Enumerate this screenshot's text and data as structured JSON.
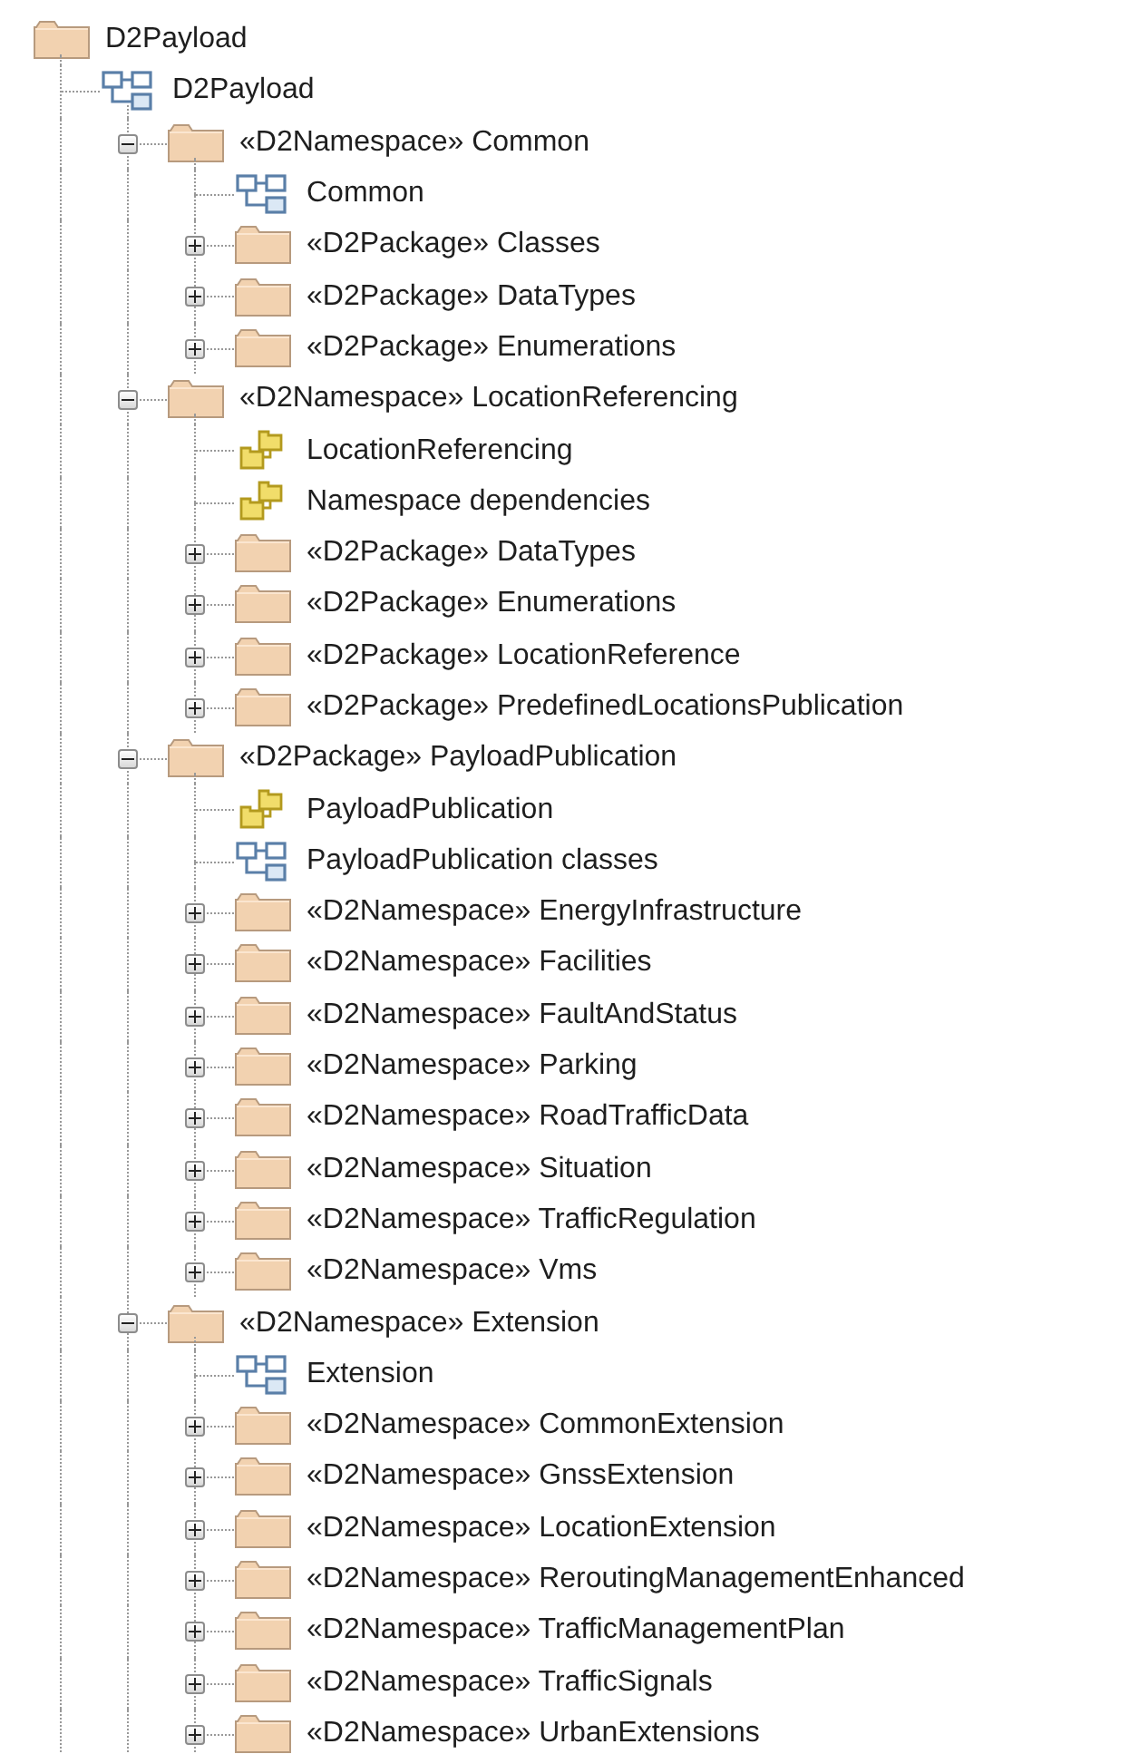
{
  "tree": [
    {
      "kind": "folder",
      "label": "D2Payload",
      "children": [
        {
          "kind": "diagram",
          "label": "D2Payload",
          "children": [
            {
              "kind": "folder",
              "label": "«D2Namespace» Common",
              "expanded": true,
              "children": [
                {
                  "kind": "diagram",
                  "label": "Common"
                },
                {
                  "kind": "folder",
                  "label": "«D2Package» Classes",
                  "expanded": false
                },
                {
                  "kind": "folder",
                  "label": "«D2Package» DataTypes",
                  "expanded": false
                },
                {
                  "kind": "folder",
                  "label": "«D2Package» Enumerations",
                  "expanded": false
                }
              ]
            },
            {
              "kind": "folder",
              "label": "«D2Namespace» LocationReferencing",
              "expanded": true,
              "children": [
                {
                  "kind": "package",
                  "label": "LocationReferencing"
                },
                {
                  "kind": "package",
                  "label": "Namespace dependencies"
                },
                {
                  "kind": "folder",
                  "label": "«D2Package» DataTypes",
                  "expanded": false
                },
                {
                  "kind": "folder",
                  "label": "«D2Package» Enumerations",
                  "expanded": false
                },
                {
                  "kind": "folder",
                  "label": "«D2Package» LocationReference",
                  "expanded": false
                },
                {
                  "kind": "folder",
                  "label": "«D2Package» PredefinedLocationsPublication",
                  "expanded": false
                }
              ]
            },
            {
              "kind": "folder",
              "label": "«D2Package» PayloadPublication",
              "expanded": true,
              "children": [
                {
                  "kind": "package",
                  "label": "PayloadPublication"
                },
                {
                  "kind": "diagram",
                  "label": "PayloadPublication classes"
                },
                {
                  "kind": "folder",
                  "label": "«D2Namespace» EnergyInfrastructure",
                  "expanded": false
                },
                {
                  "kind": "folder",
                  "label": "«D2Namespace» Facilities",
                  "expanded": false
                },
                {
                  "kind": "folder",
                  "label": "«D2Namespace» FaultAndStatus",
                  "expanded": false
                },
                {
                  "kind": "folder",
                  "label": "«D2Namespace» Parking",
                  "expanded": false
                },
                {
                  "kind": "folder",
                  "label": "«D2Namespace» RoadTrafficData",
                  "expanded": false
                },
                {
                  "kind": "folder",
                  "label": "«D2Namespace» Situation",
                  "expanded": false
                },
                {
                  "kind": "folder",
                  "label": "«D2Namespace» TrafficRegulation",
                  "expanded": false
                },
                {
                  "kind": "folder",
                  "label": "«D2Namespace» Vms",
                  "expanded": false
                }
              ]
            },
            {
              "kind": "folder",
              "label": "«D2Namespace» Extension",
              "expanded": true,
              "children": [
                {
                  "kind": "diagram",
                  "label": "Extension"
                },
                {
                  "kind": "folder",
                  "label": "«D2Namespace» CommonExtension",
                  "expanded": false
                },
                {
                  "kind": "folder",
                  "label": "«D2Namespace» GnssExtension",
                  "expanded": false
                },
                {
                  "kind": "folder",
                  "label": "«D2Namespace» LocationExtension",
                  "expanded": false
                },
                {
                  "kind": "folder",
                  "label": "«D2Namespace» ReroutingManagementEnhanced",
                  "expanded": false
                },
                {
                  "kind": "folder",
                  "label": "«D2Namespace» TrafficManagementPlan",
                  "expanded": false
                },
                {
                  "kind": "folder",
                  "label": "«D2Namespace» TrafficSignals",
                  "expanded": false
                },
                {
                  "kind": "folder",
                  "label": "«D2Namespace» UrbanExtensions",
                  "expanded": false
                }
              ]
            }
          ]
        }
      ]
    }
  ]
}
